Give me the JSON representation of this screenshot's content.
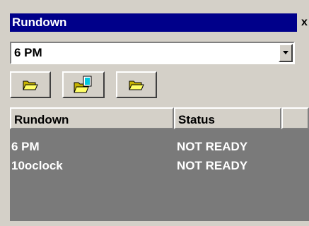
{
  "window": {
    "title": "Rundown",
    "close_label": "x"
  },
  "rundown_select": {
    "value": "6 PM"
  },
  "toolbar": {
    "buttons": [
      {
        "icon": "open-folder-icon"
      },
      {
        "icon": "open-document-icon"
      },
      {
        "icon": "open-folder-icon"
      }
    ]
  },
  "table": {
    "columns": [
      "Rundown",
      "Status"
    ],
    "rows": [
      {
        "rundown": "6 PM",
        "status": "NOT READY"
      },
      {
        "rundown": "10oclock",
        "status": "NOT READY"
      }
    ]
  },
  "colors": {
    "titlebar": "#00008a",
    "grid_body": "#7a7a7a",
    "face": "#d4d0c8"
  }
}
